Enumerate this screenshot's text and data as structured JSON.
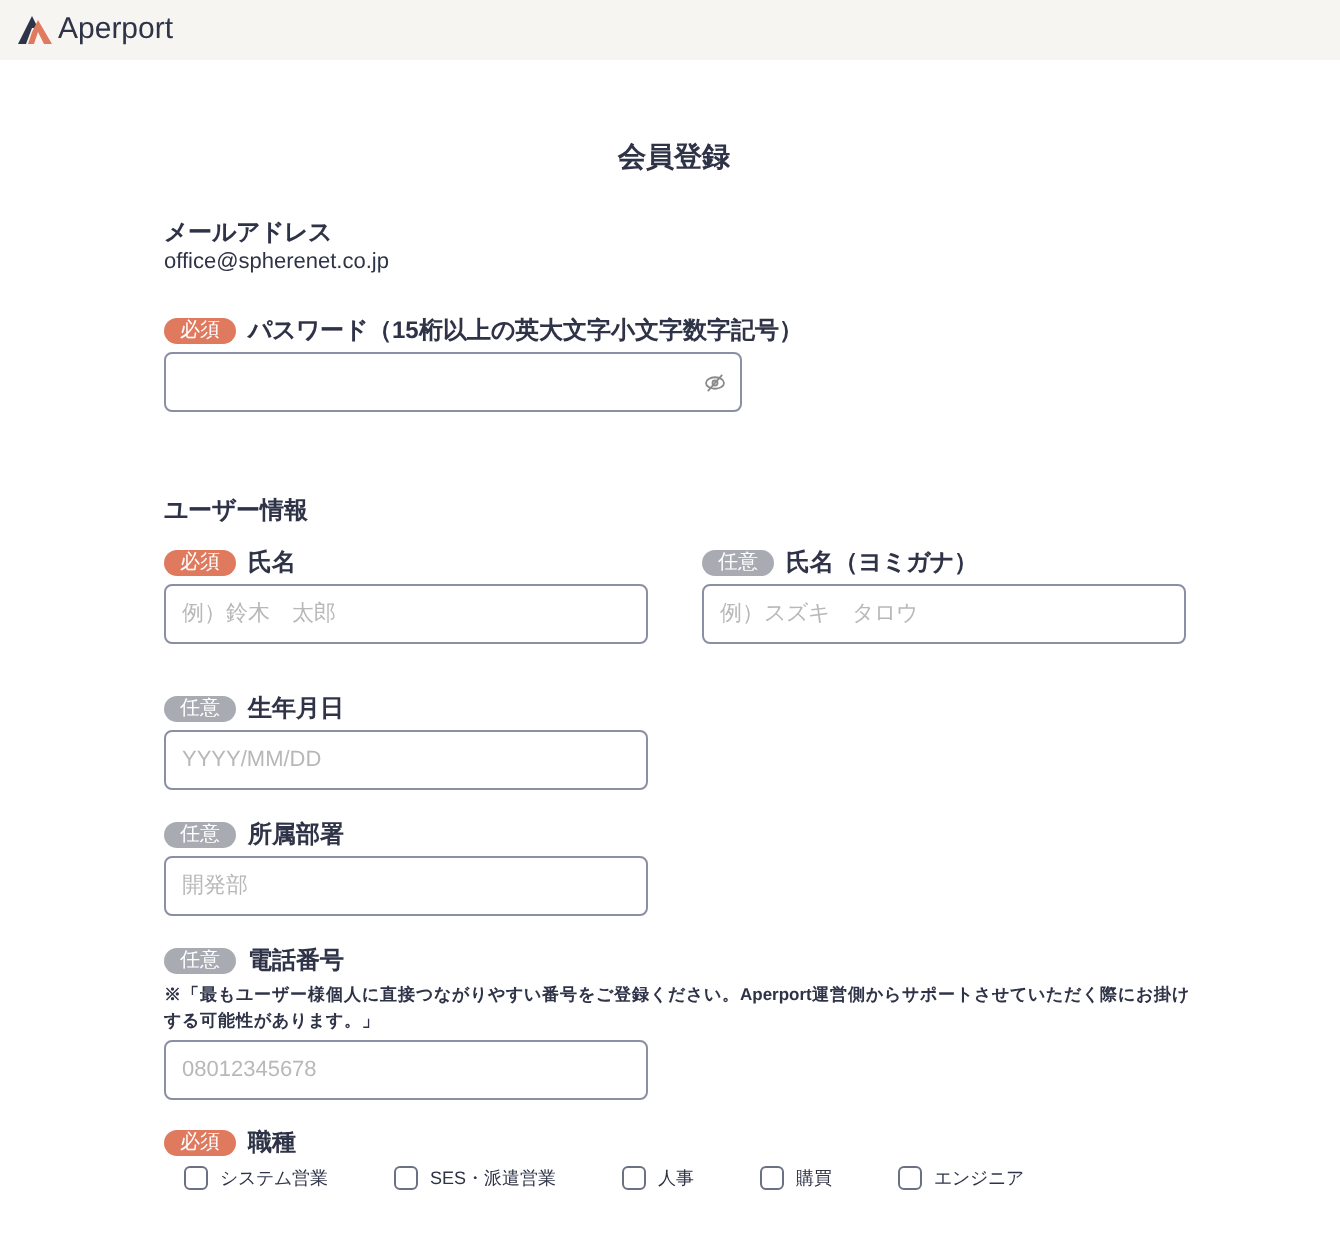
{
  "header": {
    "logo_text": "Aperport"
  },
  "title": "会員登録",
  "email": {
    "label": "メールアドレス",
    "value": "office@spherenet.co.jp"
  },
  "password": {
    "badge": {
      "kind": "required",
      "label": "必須"
    },
    "label": "パスワード（15桁以上の英大文字小文字数字記号）"
  },
  "section_heading": "ユーザー情報",
  "fields": [
    {
      "badge": {
        "kind": "required",
        "label": "必須"
      },
      "label": "氏名",
      "placeholder": "例）鈴木　太郎"
    },
    {
      "badge": {
        "kind": "optional",
        "label": "任意"
      },
      "label": "氏名（ヨミガナ）",
      "placeholder": "例）スズキ　タロウ"
    },
    {
      "badge": {
        "kind": "optional",
        "label": "任意"
      },
      "label": "生年月日",
      "placeholder": "YYYY/MM/DD"
    },
    {
      "badge": {
        "kind": "optional",
        "label": "任意"
      },
      "label": "所属部署",
      "placeholder": "開発部"
    },
    {
      "badge": {
        "kind": "optional",
        "label": "任意"
      },
      "label": "電話番号",
      "note": "※「最もユーザー様個人に直接つながりやすい番号をご登録ください。Aperport運営側からサポートさせていただく際にお掛けする可能性があります。」",
      "placeholder": "08012345678"
    }
  ],
  "job_type": {
    "badge": {
      "kind": "required",
      "label": "必須"
    },
    "label": "職種",
    "options": [
      {
        "label": "システム営業",
        "checked": false
      },
      {
        "label": "SES・派遣営業",
        "checked": false
      },
      {
        "label": "人事",
        "checked": false
      },
      {
        "label": "購買",
        "checked": false
      },
      {
        "label": "エンジニア",
        "checked": false
      }
    ]
  }
}
